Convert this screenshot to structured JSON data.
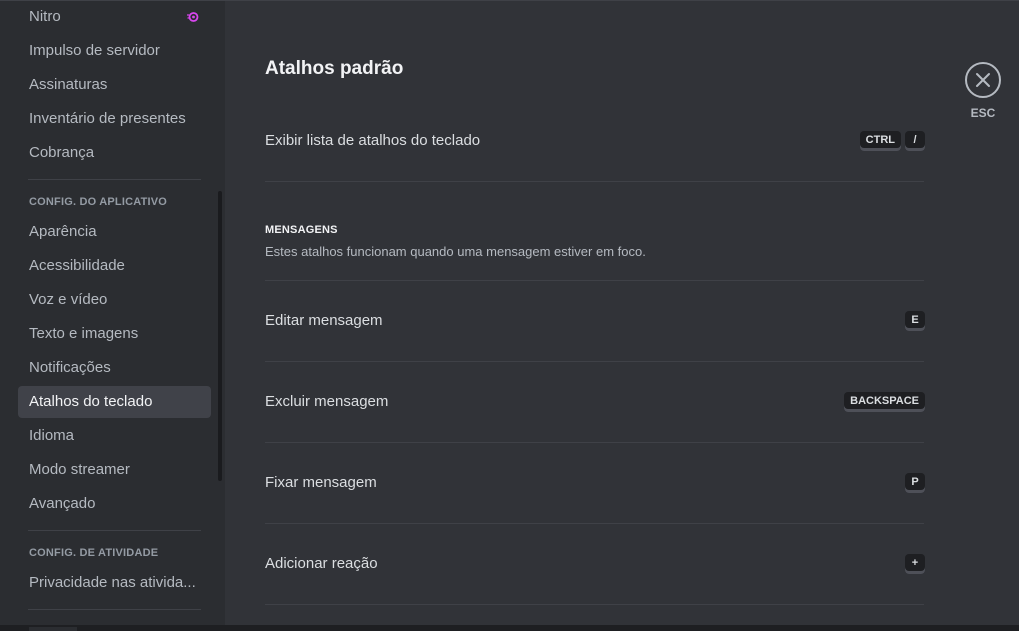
{
  "sidebar": {
    "items": [
      {
        "label": "Nitro"
      },
      {
        "label": "Impulso de servidor"
      },
      {
        "label": "Assinaturas"
      },
      {
        "label": "Inventário de presentes"
      },
      {
        "label": "Cobrança"
      }
    ],
    "app_settings_header": "CONFIG. DO APLICATIVO",
    "app_items": [
      {
        "label": "Aparência"
      },
      {
        "label": "Acessibilidade"
      },
      {
        "label": "Voz e vídeo"
      },
      {
        "label": "Texto e imagens"
      },
      {
        "label": "Notificações"
      },
      {
        "label": "Atalhos do teclado",
        "active": true
      },
      {
        "label": "Idioma"
      },
      {
        "label": "Modo streamer"
      },
      {
        "label": "Avançado"
      }
    ],
    "activity_header": "CONFIG. DE ATIVIDADE",
    "activity_items": [
      {
        "label": "Privacidade nas ativida..."
      }
    ],
    "nitro_icon": "nitro-icon",
    "nitro_color": "#d946ef"
  },
  "main": {
    "title": "Atalhos padrão",
    "default_shortcut": {
      "label": "Exibir lista de atalhos do teclado",
      "keys": [
        "CTRL",
        "/"
      ]
    },
    "messages_section": {
      "title": "MENSAGENS",
      "description": "Estes atalhos funcionam quando uma mensagem estiver em foco.",
      "shortcuts": [
        {
          "label": "Editar mensagem",
          "key": "E"
        },
        {
          "label": "Excluir mensagem",
          "key": "BACKSPACE"
        },
        {
          "label": "Fixar mensagem",
          "key": "P"
        },
        {
          "label": "Adicionar reação",
          "key": "+"
        }
      ]
    }
  },
  "close": {
    "icon": "close-icon",
    "label": "ESC"
  },
  "colors": {
    "background": "#313338",
    "sidebar": "#2b2d31",
    "active_item": "#404249",
    "key_bg": "#1e1f22"
  }
}
